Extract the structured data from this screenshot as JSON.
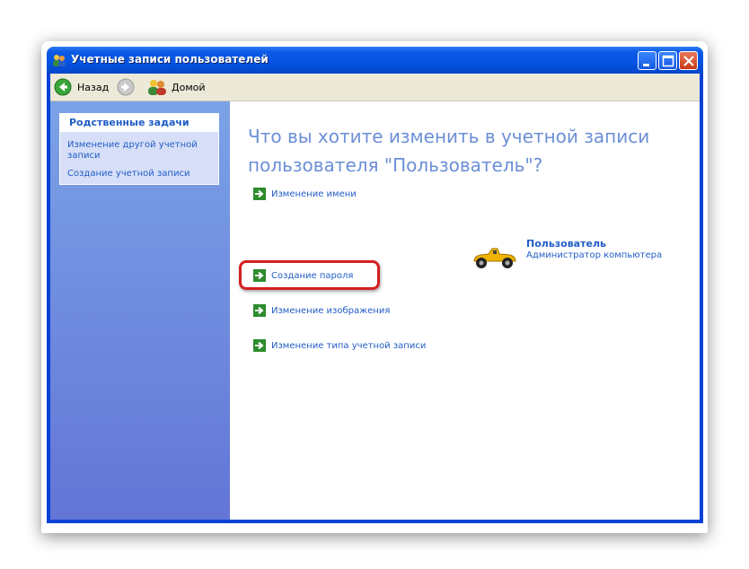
{
  "window": {
    "title": "Учетные записи пользователей"
  },
  "toolbar": {
    "back_label": "Назад",
    "home_label": "Домой"
  },
  "sidebar": {
    "heading": "Родственные задачи",
    "links": [
      "Изменение другой учетной записи",
      "Создание учетной записи"
    ]
  },
  "main": {
    "headline": "Что вы хотите изменить в учетной записи пользователя \"Пользователь\"?",
    "actions": [
      "Изменение имени",
      "Создание пароля",
      "Изменение изображения",
      "Изменение типа учетной записи"
    ],
    "user": {
      "name": "Пользователь",
      "role": "Администратор компьютера"
    }
  },
  "colors": {
    "titlebar": "#0553e2",
    "link": "#215dc6",
    "headline": "#6b8fd6",
    "highlight": "#d42020",
    "sidebar": "#7ba2e7"
  }
}
